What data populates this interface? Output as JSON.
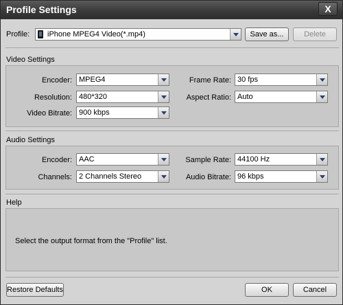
{
  "window": {
    "title": "Profile Settings",
    "close_label": "X"
  },
  "profile": {
    "label": "Profile:",
    "value": "iPhone MPEG4 Video(*.mp4)",
    "save_as": "Save as...",
    "delete": "Delete"
  },
  "video": {
    "section_title": "Video Settings",
    "encoder": {
      "label": "Encoder:",
      "value": "MPEG4"
    },
    "resolution": {
      "label": "Resolution:",
      "value": "480*320"
    },
    "bitrate": {
      "label": "Video Bitrate:",
      "value": "900 kbps"
    },
    "frame_rate": {
      "label": "Frame Rate:",
      "value": "30 fps"
    },
    "aspect_ratio": {
      "label": "Aspect Ratio:",
      "value": "Auto"
    }
  },
  "audio": {
    "section_title": "Audio Settings",
    "encoder": {
      "label": "Encoder:",
      "value": "AAC"
    },
    "channels": {
      "label": "Channels:",
      "value": "2 Channels Stereo"
    },
    "sample_rate": {
      "label": "Sample Rate:",
      "value": "44100 Hz"
    },
    "bitrate": {
      "label": "Audio Bitrate:",
      "value": "96 kbps"
    }
  },
  "help": {
    "section_title": "Help",
    "text": "Select the output format from the \"Profile\" list."
  },
  "footer": {
    "restore": "Restore Defaults",
    "ok": "OK",
    "cancel": "Cancel"
  },
  "icons": {
    "profile": "phone-icon",
    "dropdown": "chevron-down-icon",
    "close": "close-icon"
  }
}
